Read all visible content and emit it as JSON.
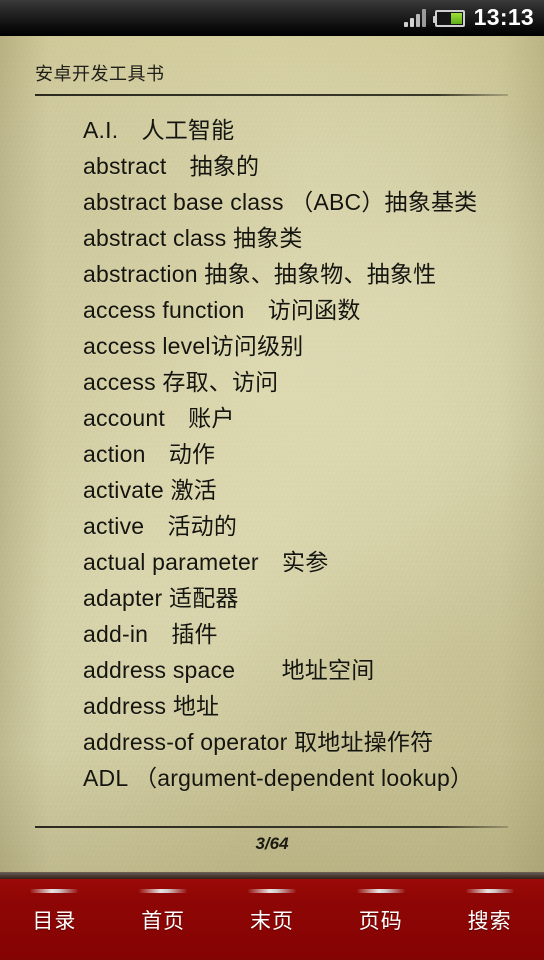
{
  "statusbar": {
    "time": "13:13",
    "signal_icon": "signal-bars-icon",
    "battery_icon": "battery-icon",
    "battery_level_percent": 45
  },
  "reader": {
    "book_title": "安卓开发工具书",
    "page_indicator": "3/64",
    "entries": [
      "A.I.　人工智能",
      "abstract　抽象的",
      "abstract base class （ABC）抽象基类",
      "abstract class 抽象类",
      "abstraction 抽象、抽象物、抽象性",
      "access function　访问函数",
      "access level访问级别",
      "access 存取、访问",
      "account　账户",
      "action　动作",
      "activate 激活",
      "active　活动的",
      "actual parameter　实参",
      "adapter 适配器",
      "add-in　插件",
      "address space　　地址空间",
      "address 地址",
      "address-of operator 取地址操作符",
      "ADL （argument-dependent lookup）"
    ]
  },
  "toolbar": {
    "tabs": [
      {
        "label": "目录"
      },
      {
        "label": "首页"
      },
      {
        "label": "末页"
      },
      {
        "label": "页码"
      },
      {
        "label": "搜索"
      }
    ]
  },
  "colors": {
    "paper": "#d2cea4",
    "toolbar_red": "#8d0605",
    "statusbar_black": "#111111",
    "text": "#15150f"
  }
}
